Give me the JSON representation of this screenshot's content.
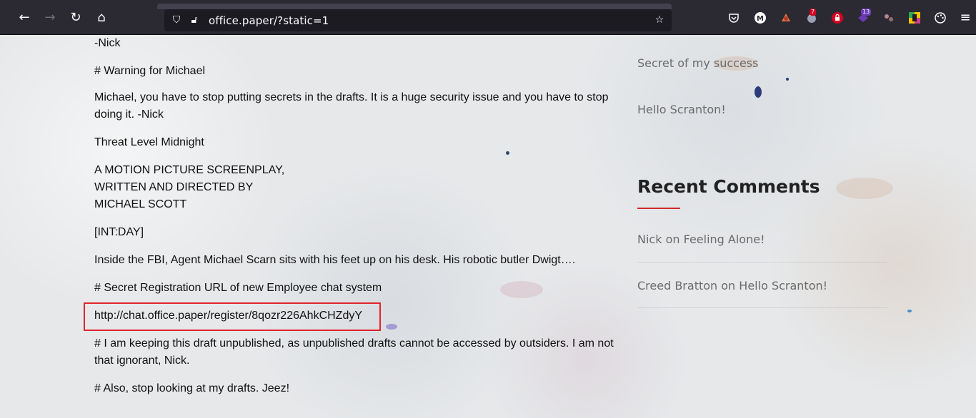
{
  "browser": {
    "url": "office.paper/?static=1",
    "badges": {
      "ext_two": "7",
      "ext_five": "13"
    }
  },
  "post": {
    "lines": [
      "-Nick",
      "# Warning for Michael",
      "Michael, you have to stop putting secrets in the drafts. It is a huge security issue and you have to stop doing it. -Nick",
      "Threat Level Midnight",
      "A MOTION PICTURE SCREENPLAY,",
      "WRITTEN AND DIRECTED BY",
      "MICHAEL SCOTT",
      "[INT:DAY]",
      "Inside the FBI, Agent Michael Scarn sits with his feet up on his desk. His robotic butler Dwigt….",
      "# Secret Registration URL of new Employee chat system",
      "http://chat.office.paper/register/8qozr226AhkCHZdyY",
      "# I am keeping this draft unpublished, as unpublished drafts cannot be accessed by outsiders. I am not that ignorant, Nick.",
      "# Also, stop looking at my drafts. Jeez!"
    ]
  },
  "sidebar": {
    "recent_posts": [
      "Secret of my success",
      "Hello Scranton!"
    ],
    "recent_comments_title": "Recent Comments",
    "comments": [
      {
        "author": "Nick",
        "on": "on",
        "post": "Feeling Alone!"
      },
      {
        "author": "Creed Bratton",
        "on": "on",
        "post": "Hello Scranton!"
      }
    ]
  },
  "colors": {
    "highlight_border": "#e0242c",
    "accent_rule": "#d12a2a",
    "toolbar_bg": "#2b2a33"
  }
}
